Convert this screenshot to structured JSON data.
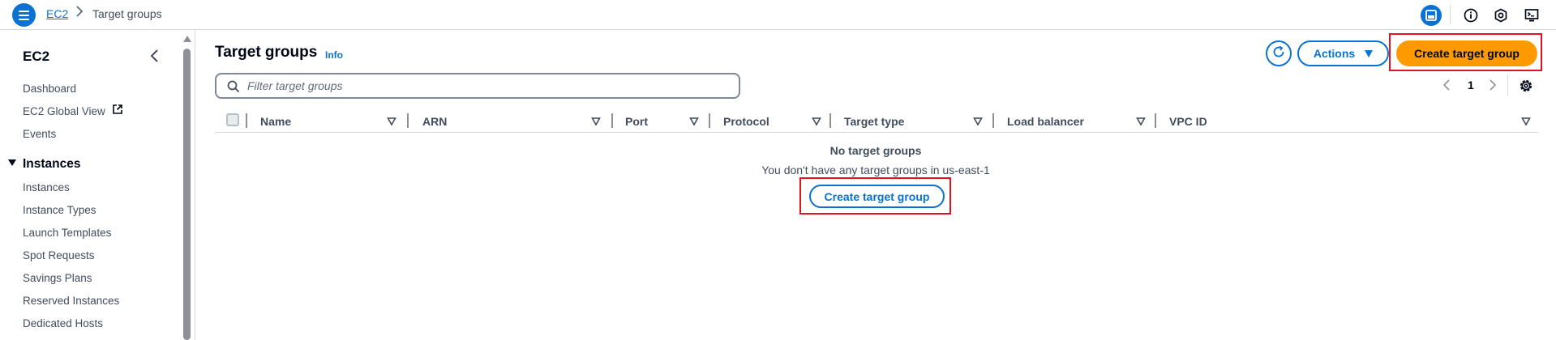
{
  "breadcrumb": {
    "root": "EC2",
    "current": "Target groups"
  },
  "topbar_icons": [
    "split-panel-icon",
    "info-icon",
    "notifications-icon",
    "cloudshell-icon"
  ],
  "sidebar": {
    "title": "EC2",
    "items": [
      {
        "label": "Dashboard"
      },
      {
        "label": "EC2 Global View"
      },
      {
        "label": "Events"
      }
    ],
    "section": {
      "label": "Instances",
      "items": [
        {
          "label": "Instances"
        },
        {
          "label": "Instance Types"
        },
        {
          "label": "Launch Templates"
        },
        {
          "label": "Spot Requests"
        },
        {
          "label": "Savings Plans"
        },
        {
          "label": "Reserved Instances"
        },
        {
          "label": "Dedicated Hosts"
        }
      ]
    }
  },
  "header": {
    "title": "Target groups",
    "info": "Info",
    "actions_label": "Actions",
    "create_label": "Create target group"
  },
  "search": {
    "placeholder": "Filter target groups",
    "value": ""
  },
  "pagination": {
    "page": "1"
  },
  "table": {
    "columns": [
      "Name",
      "ARN",
      "Port",
      "Protocol",
      "Target type",
      "Load balancer",
      "VPC ID"
    ]
  },
  "empty_state": {
    "title": "No target groups",
    "subtitle": "You don't have any target groups in us-east-1",
    "button_label": "Create target group"
  },
  "colors": {
    "accent": "#0972d3",
    "primary_button": "#ff9900",
    "highlight": "#e0141e"
  }
}
